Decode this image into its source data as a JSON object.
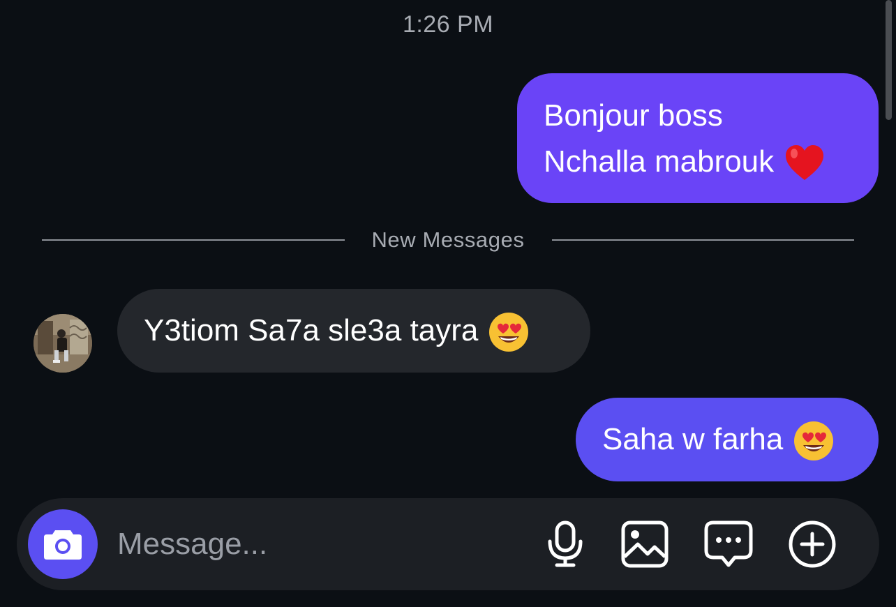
{
  "timestamp": "1:26 PM",
  "divider": {
    "label": "New Messages"
  },
  "messages": [
    {
      "direction": "outgoing",
      "lines": [
        "Bonjour boss",
        "Nchalla mabrouk"
      ],
      "emoji": "red-heart"
    },
    {
      "direction": "incoming",
      "text": "Y3tiom Sa7a sle3a tayra",
      "emoji": "heart-eyes"
    },
    {
      "direction": "outgoing",
      "text": "Saha w farha",
      "emoji": "heart-eyes"
    }
  ],
  "composer": {
    "placeholder": "Message...",
    "icons": [
      "camera-icon",
      "microphone-icon",
      "image-icon",
      "chat-bubble-icon",
      "plus-circle-icon"
    ]
  },
  "colors": {
    "background": "#0b0f14",
    "outgoing_bubble": "#6a44f7",
    "outgoing_bubble_alt": "#5b4ff2",
    "incoming_bubble": "#24272c",
    "composer": "#1c1f24",
    "accent": "#5b4ff2"
  }
}
